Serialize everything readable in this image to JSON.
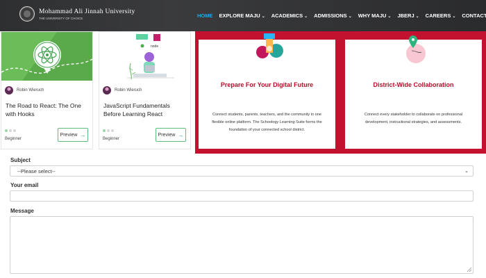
{
  "header": {
    "logo_name": "Mohammad Ali Jinnah University",
    "logo_tagline": "THE UNIVERSITY OF CHOICE",
    "nav": [
      {
        "label": "HOME",
        "active": true,
        "has_dropdown": false
      },
      {
        "label": "EXPLORE MAJU",
        "active": false,
        "has_dropdown": true
      },
      {
        "label": "ACADEMICS",
        "active": false,
        "has_dropdown": true
      },
      {
        "label": "ADMISSIONS",
        "active": false,
        "has_dropdown": true
      },
      {
        "label": "WHY MAJU",
        "active": false,
        "has_dropdown": true
      },
      {
        "label": "JBERJ",
        "active": false,
        "has_dropdown": true
      },
      {
        "label": "CAREERS",
        "active": false,
        "has_dropdown": true
      },
      {
        "label": "CONTACT",
        "active": false,
        "has_dropdown": false
      }
    ],
    "search_icon": "search-icon",
    "accent_color": "#29a7e1"
  },
  "courses": [
    {
      "author": "Robin Wieruch",
      "title": "The Road to React: The One with Hooks",
      "level": "Beginner",
      "preview_label": "Preview",
      "image_icon": "react-atom-icon",
      "progress_dots": [
        true,
        false,
        false
      ]
    },
    {
      "author": "Robin Wieruch",
      "title": "JavaScript Fundamentals Before Learning React",
      "level": "Beginner",
      "preview_label": "Preview",
      "image_icon": "developer-laptop-illustration",
      "image_tags": [
        "node"
      ],
      "progress_dots": [
        true,
        false,
        false
      ]
    }
  ],
  "banner": {
    "color": "#c2122f",
    "panels": [
      {
        "title": "Prepare For Your Digital Future",
        "body": "Connect students, parents, teachers, and the community in one flexible online platform. The Schoology Learning Suite forms the foundation of your connected school district.",
        "icon": "digital-future-illustration"
      },
      {
        "title": "District-Wide Collaboration",
        "body": "Connect every stakeholder to collaborate on professional development, instructional strategies, and assessments.",
        "icon": "map-pin-illustration"
      }
    ]
  },
  "form": {
    "subject_label": "Subject",
    "subject_value": "--Please select--",
    "email_label": "Your email",
    "email_value": "",
    "message_label": "Message",
    "message_value": ""
  }
}
